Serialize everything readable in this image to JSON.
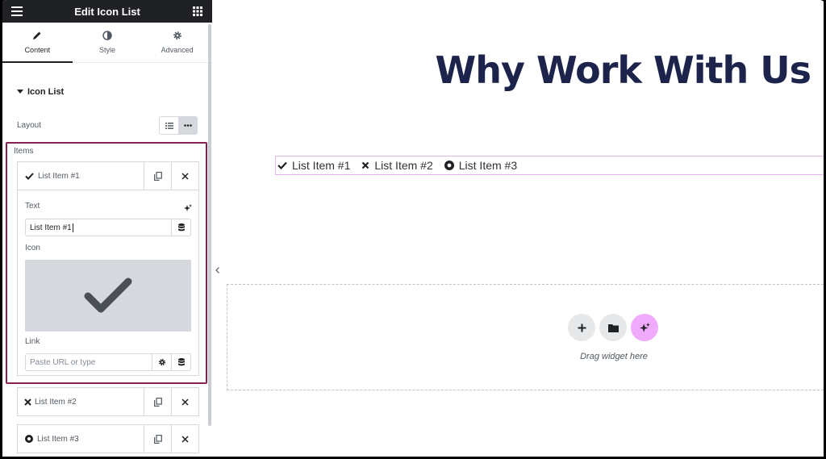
{
  "panel": {
    "title": "Edit Icon List",
    "tabs": [
      {
        "label": "Content",
        "icon": "pencil-icon",
        "active": true
      },
      {
        "label": "Style",
        "icon": "half-circle-icon",
        "active": false
      },
      {
        "label": "Advanced",
        "icon": "gear-icon",
        "active": false
      }
    ],
    "section_title": "Icon List",
    "layout_label": "Layout",
    "layout_options": [
      "default-list",
      "inline"
    ],
    "layout_selected": "inline",
    "items_label": "Items",
    "items": [
      {
        "label": "List Item #1",
        "icon": "check-icon",
        "expanded": true
      },
      {
        "label": "List Item #2",
        "icon": "times-icon",
        "expanded": false
      },
      {
        "label": "List Item #3",
        "icon": "dot-circle-icon",
        "expanded": false
      }
    ],
    "editor": {
      "text_label": "Text",
      "text_value": "List Item #1",
      "icon_label": "Icon",
      "link_label": "Link",
      "link_placeholder": "Paste URL or type"
    }
  },
  "canvas": {
    "heading": "Why Work With Us",
    "list": [
      {
        "label": "List Item #1",
        "icon": "check-icon"
      },
      {
        "label": "List Item #2",
        "icon": "times-icon"
      },
      {
        "label": "List Item #3",
        "icon": "dot-circle-icon"
      }
    ],
    "drop_text": "Drag widget here"
  },
  "colors": {
    "heading": "#1c244b",
    "highlight_border": "#8a2052",
    "ai_button": "#f0abfc",
    "topbar": "#1f2124"
  }
}
